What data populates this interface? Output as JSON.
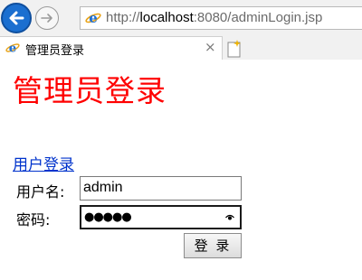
{
  "browser": {
    "url_prefix": "http://",
    "url_host": "localhost",
    "url_rest": ":8080/adminLogin.jsp",
    "tab_title": "管理员登录",
    "tab_close": "×"
  },
  "page": {
    "heading": "管理员登录",
    "user_login_link": "用户登录",
    "form": {
      "username_label": "用户名:",
      "username_value": "admin",
      "password_label": "密码:",
      "password_masked": "●●●●●",
      "submit_label": "登 录"
    }
  },
  "colors": {
    "heading": "#ff0000",
    "link": "#0033cc",
    "back_button": "#1b6fd0"
  },
  "icons": [
    "back-arrow-icon",
    "forward-arrow-icon",
    "ie-logo-icon",
    "close-icon",
    "new-tab-icon",
    "reveal-password-icon"
  ]
}
